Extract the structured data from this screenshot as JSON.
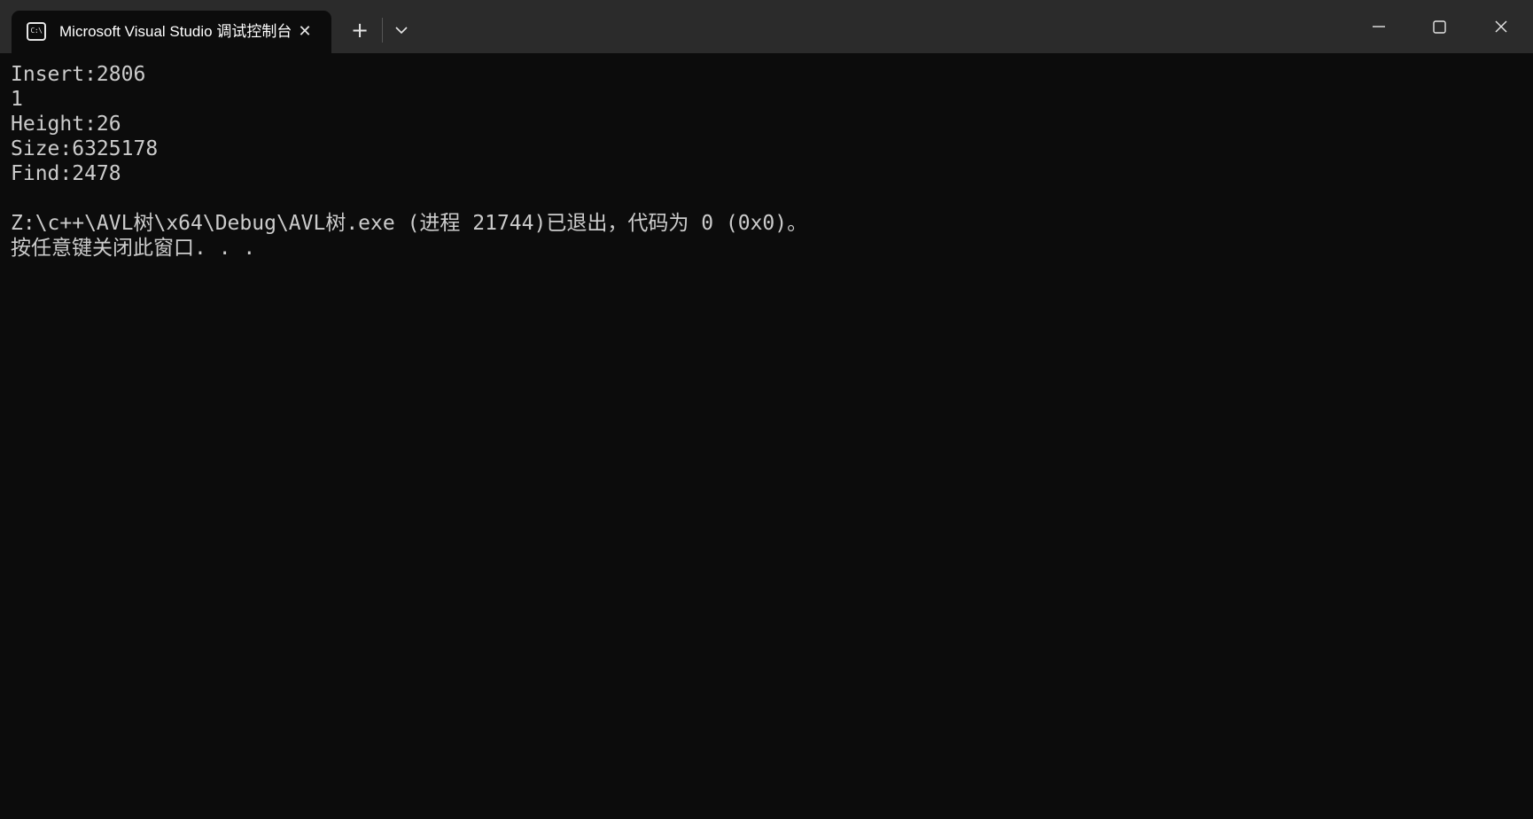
{
  "tab": {
    "icon": "console-icon",
    "icon_glyph": "C:\\",
    "title": "Microsoft Visual Studio 调试控制台",
    "close_icon": "close-icon"
  },
  "titlebar": {
    "new_tab_icon": "plus-icon",
    "new_tab_glyph": "+",
    "dropdown_icon": "chevron-down-icon",
    "minimize_icon": "minimize-icon",
    "maximize_icon": "maximize-icon",
    "close_icon": "close-icon"
  },
  "console": {
    "lines": [
      "Insert:2806",
      "1",
      "Height:26",
      "Size:6325178",
      "Find:2478",
      "",
      "Z:\\c++\\AVL树\\x64\\Debug\\AVL树.exe (进程 21744)已退出，代码为 0 (0x0)。",
      "按任意键关闭此窗口. . ."
    ]
  },
  "colors": {
    "background": "#0c0c0c",
    "titlebar": "#2b2b2b",
    "text": "#cccccc"
  }
}
